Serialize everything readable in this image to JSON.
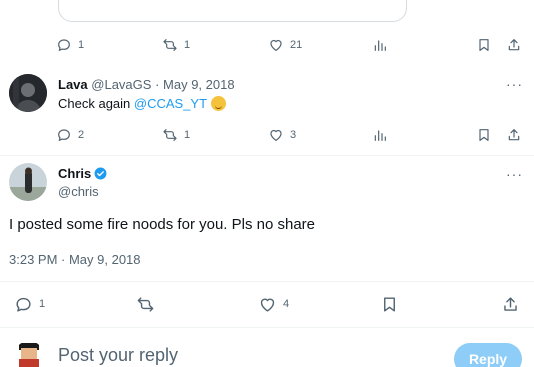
{
  "top_tweet": {
    "actions": {
      "reply_count": "1",
      "retweet_count": "1",
      "like_count": "21"
    }
  },
  "reply_tweet": {
    "name": "Lava",
    "handle": "@LavaGS",
    "date": "May 9, 2018",
    "text_prefix": "Check again ",
    "mention": "@CCAS_YT",
    "emoji": "wink-emoji",
    "more": "···",
    "actions": {
      "reply_count": "2",
      "retweet_count": "1",
      "like_count": "3"
    }
  },
  "main_tweet": {
    "name": "Chris",
    "handle": "@chris",
    "verified": true,
    "text": "I posted some fire noods for you. Pls no share",
    "timestamp": "3:23 PM · May 9, 2018",
    "more": "···",
    "actions": {
      "reply_count": "1",
      "like_count": "4"
    }
  },
  "reply_box": {
    "placeholder": "Post your reply",
    "button_label": "Reply"
  },
  "colors": {
    "accent": "#1d9bf0",
    "muted": "#536471",
    "reply_button_disabled": "#8ecdf7"
  },
  "icons": [
    "reply-icon",
    "retweet-icon",
    "like-icon",
    "views-icon",
    "bookmark-icon",
    "share-icon",
    "verified-icon"
  ]
}
